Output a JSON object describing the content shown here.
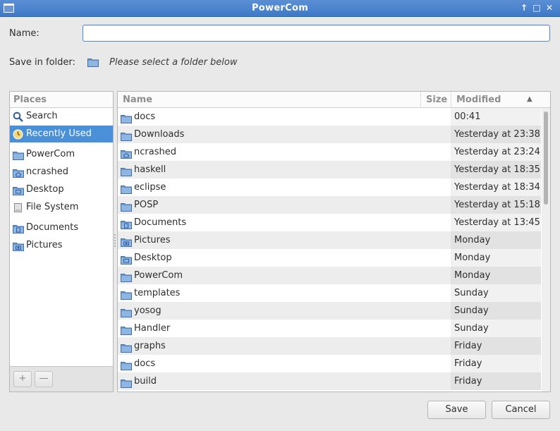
{
  "window": {
    "title": "PowerCom",
    "controls": [
      "↑",
      "□",
      "✕"
    ]
  },
  "form": {
    "name_label": "Name:",
    "name_value": "",
    "save_in_label": "Save in folder:",
    "save_in_hint": "Please select a folder below"
  },
  "places": {
    "header": "Places",
    "items": [
      {
        "label": "Search",
        "icon": "search-icon"
      },
      {
        "label": "Recently Used",
        "icon": "recent-icon",
        "active": true
      },
      {
        "label": "PowerCom",
        "icon": "folder-icon"
      },
      {
        "label": "ncrashed",
        "icon": "home-folder-icon"
      },
      {
        "label": "Desktop",
        "icon": "desktop-folder-icon"
      },
      {
        "label": "File System",
        "icon": "drive-icon"
      },
      {
        "label": "Documents",
        "icon": "documents-folder-icon"
      },
      {
        "label": "Pictures",
        "icon": "pictures-folder-icon"
      }
    ],
    "add_label": "+",
    "remove_label": "—"
  },
  "files": {
    "columns": {
      "name": "Name",
      "size": "Size",
      "modified": "Modified"
    },
    "rows": [
      {
        "name": "docs",
        "modified": "00:41",
        "icon": "folder-icon"
      },
      {
        "name": "Downloads",
        "modified": "Yesterday at 23:38",
        "icon": "folder-icon"
      },
      {
        "name": "ncrashed",
        "modified": "Yesterday at 23:24",
        "icon": "home-folder-icon"
      },
      {
        "name": "haskell",
        "modified": "Yesterday at 18:35",
        "icon": "folder-icon"
      },
      {
        "name": "eclipse",
        "modified": "Yesterday at 18:34",
        "icon": "folder-icon"
      },
      {
        "name": "POSP",
        "modified": "Yesterday at 15:18",
        "icon": "folder-icon"
      },
      {
        "name": "Documents",
        "modified": "Yesterday at 13:45",
        "icon": "documents-folder-icon"
      },
      {
        "name": "Pictures",
        "modified": "Monday",
        "icon": "pictures-folder-icon"
      },
      {
        "name": "Desktop",
        "modified": "Monday",
        "icon": "desktop-folder-icon"
      },
      {
        "name": "PowerCom",
        "modified": "Monday",
        "icon": "folder-icon"
      },
      {
        "name": "templates",
        "modified": "Sunday",
        "icon": "folder-icon"
      },
      {
        "name": "yosog",
        "modified": "Sunday",
        "icon": "folder-icon"
      },
      {
        "name": "Handler",
        "modified": "Sunday",
        "icon": "folder-icon"
      },
      {
        "name": "graphs",
        "modified": "Friday",
        "icon": "folder-icon"
      },
      {
        "name": "docs",
        "modified": "Friday",
        "icon": "folder-icon"
      },
      {
        "name": "build",
        "modified": "Friday",
        "icon": "folder-icon"
      }
    ]
  },
  "buttons": {
    "save": "Save",
    "cancel": "Cancel"
  },
  "colors": {
    "accent": "#4a90d9",
    "titlebar": "#3e79c7",
    "folder": "#6b9bd2"
  }
}
